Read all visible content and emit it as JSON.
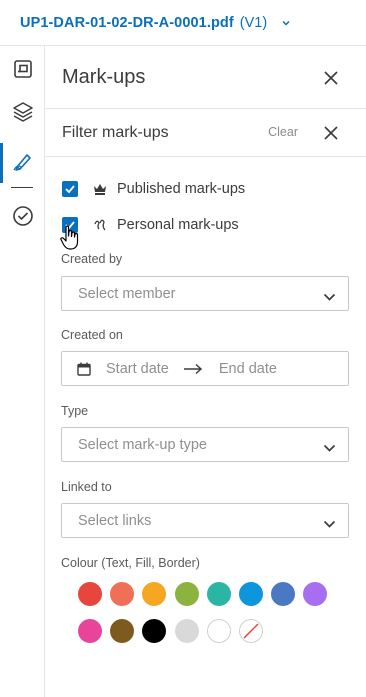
{
  "file": {
    "name": "UP1-DAR-01-02-DR-A-0001.pdf",
    "version": "(V1)"
  },
  "rail": {
    "items": [
      {
        "icon": "sheet-icon"
      },
      {
        "icon": "layers-icon"
      },
      {
        "icon": "markup-pen-icon",
        "active": true
      },
      {
        "icon": "check-circle-icon"
      }
    ]
  },
  "panel": {
    "title": "Mark-ups",
    "filter_title": "Filter mark-ups",
    "clear_label": "Clear"
  },
  "filters": {
    "published": {
      "label": "Published mark-ups",
      "checked": true,
      "icon": "crown-icon"
    },
    "personal": {
      "label": "Personal mark-ups",
      "checked": true,
      "icon": "squiggle-icon"
    },
    "created_by": {
      "label": "Created by",
      "placeholder": "Select member"
    },
    "created_on": {
      "label": "Created on",
      "start_placeholder": "Start date",
      "end_placeholder": "End date"
    },
    "type": {
      "label": "Type",
      "placeholder": "Select mark-up type"
    },
    "linked_to": {
      "label": "Linked to",
      "placeholder": "Select links"
    },
    "colour": {
      "label": "Colour (Text, Fill, Border)",
      "swatches": [
        "#e8453c",
        "#ef6f57",
        "#f5a623",
        "#8db33f",
        "#2bb5a4",
        "#0d96db",
        "#4a78c2",
        "#a86ef0",
        "#e8449a",
        "#7d5a1e",
        "#000000",
        "#d9d9d9",
        "#ffffff",
        "none"
      ]
    }
  }
}
